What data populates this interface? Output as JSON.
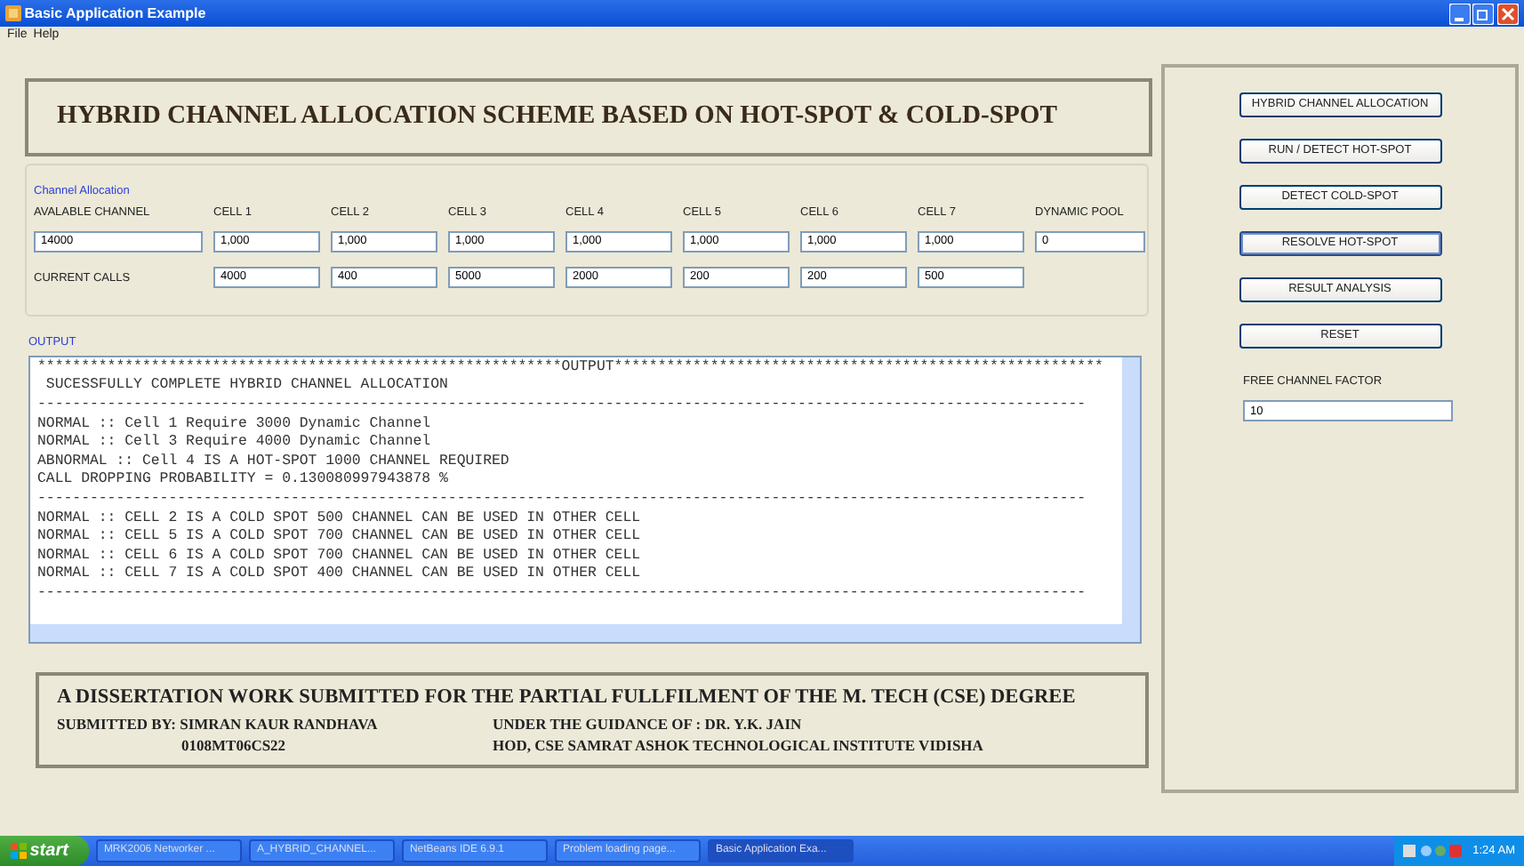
{
  "window": {
    "title": "Basic Application Example"
  },
  "menu": [
    "File",
    "Help"
  ],
  "heading": "HYBRID CHANNEL ALLOCATION SCHEME BASED ON HOT-SPOT & COLD-SPOT",
  "channel_allocation": {
    "label": "Channel Allocation",
    "available_channel": {
      "label": "AVALABLE CHANNEL",
      "value": "14000"
    },
    "current_calls_label": "CURRENT CALLS",
    "cells": [
      {
        "label": "CELL 1",
        "channels": "1,000",
        "current_calls": "4000"
      },
      {
        "label": "CELL 2",
        "channels": "1,000",
        "current_calls": "400"
      },
      {
        "label": "CELL 3",
        "channels": "1,000",
        "current_calls": "5000"
      },
      {
        "label": "CELL 4",
        "channels": "1,000",
        "current_calls": "2000"
      },
      {
        "label": "CELL 5",
        "channels": "1,000",
        "current_calls": "200"
      },
      {
        "label": "CELL 6",
        "channels": "1,000",
        "current_calls": "200"
      },
      {
        "label": "CELL 7",
        "channels": "1,000",
        "current_calls": "500"
      }
    ],
    "dynamic_pool": {
      "label": "DYNAMIC POOL",
      "value": "0"
    }
  },
  "output": {
    "label": "OUTPUT",
    "lines": [
      "************************************************************OUTPUT********************************************************",
      " SUCESSFULLY COMPLETE HYBRID CHANNEL ALLOCATION",
      "------------------------------------------------------------------------------------------------------------------------",
      "NORMAL :: Cell 1 Require 3000 Dynamic Channel",
      "NORMAL :: Cell 3 Require 4000 Dynamic Channel",
      "ABNORMAL :: Cell 4 IS A HOT-SPOT 1000 CHANNEL REQUIRED",
      "CALL DROPPING PROBABILITY = 0.130080997943878 %",
      "------------------------------------------------------------------------------------------------------------------------",
      "NORMAL :: CELL 2 IS A COLD SPOT 500 CHANNEL CAN BE USED IN OTHER CELL",
      "NORMAL :: CELL 5 IS A COLD SPOT 700 CHANNEL CAN BE USED IN OTHER CELL",
      "NORMAL :: CELL 6 IS A COLD SPOT 700 CHANNEL CAN BE USED IN OTHER CELL",
      "NORMAL :: CELL 7 IS A COLD SPOT 400 CHANNEL CAN BE USED IN OTHER CELL",
      "------------------------------------------------------------------------------------------------------------------------"
    ]
  },
  "buttons": [
    {
      "label": "HYBRID CHANNEL ALLOCATION",
      "focused": false
    },
    {
      "label": "RUN / DETECT HOT-SPOT",
      "focused": false
    },
    {
      "label": "DETECT COLD-SPOT",
      "focused": false
    },
    {
      "label": "RESOLVE HOT-SPOT",
      "focused": true
    },
    {
      "label": "RESULT ANALYSIS",
      "focused": false
    },
    {
      "label": "RESET",
      "focused": false
    }
  ],
  "free_channel_factor": {
    "label": "FREE CHANNEL FACTOR",
    "value": "10"
  },
  "footer": {
    "title": "A DISSERTATION WORK SUBMITTED FOR THE PARTIAL FULLFILMENT OF THE M. TECH (CSE) DEGREE",
    "submitted_by": "SUBMITTED BY: SIMRAN KAUR RANDHAVA",
    "roll_no": "0108MT06CS22",
    "guidance": "UNDER THE GUIDANCE OF : DR. Y.K. JAIN",
    "hod": "HOD, CSE SAMRAT ASHOK TECHNOLOGICAL INSTITUTE VIDISHA"
  },
  "taskbar": {
    "start": "start",
    "items": [
      {
        "label": "MRK2006 Networker ...",
        "selected": false
      },
      {
        "label": "A_HYBRID_CHANNEL...",
        "selected": false
      },
      {
        "label": "NetBeans IDE 6.9.1",
        "selected": false
      },
      {
        "label": "Problem loading page...",
        "selected": false
      },
      {
        "label": "Basic Application Exa...",
        "selected": true
      }
    ],
    "clock": "1:24 AM"
  }
}
